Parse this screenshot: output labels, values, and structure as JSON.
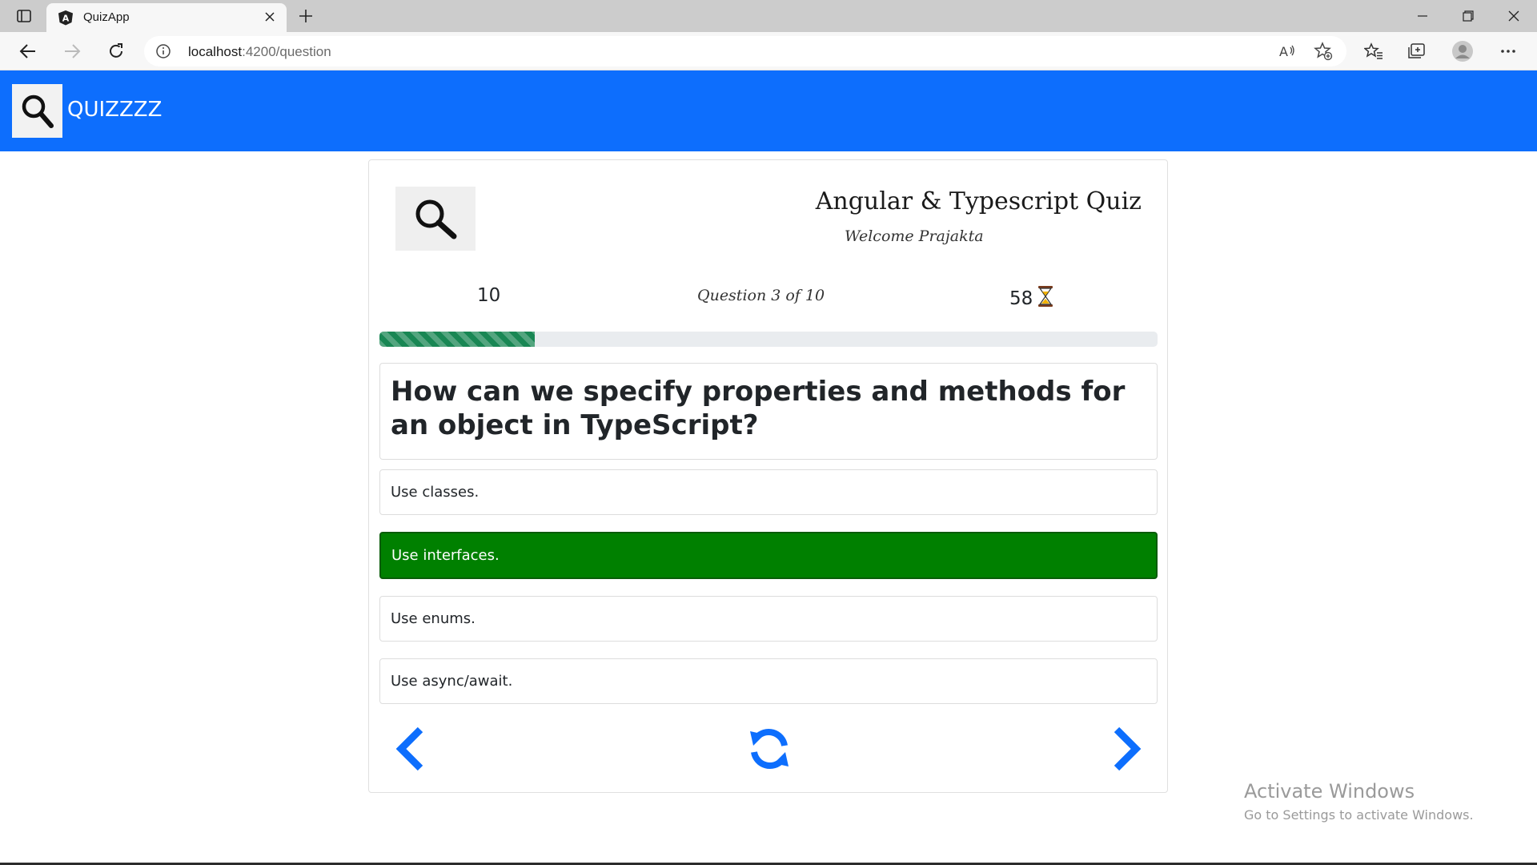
{
  "browser": {
    "tab_title": "QuizApp",
    "url_host": "localhost",
    "url_rest": ":4200/question"
  },
  "navbar": {
    "brand": "QUIZZZZ"
  },
  "quiz": {
    "title": "Angular & Typescript Quiz",
    "welcome": "Welcome Prajakta",
    "points": "10",
    "question_counter": "Question 3 of 10",
    "timer": "58",
    "progress_percent": 20,
    "question": "How can we specify properties and methods for an object in TypeScript?",
    "options": [
      {
        "label": "Use classes.",
        "selected": false
      },
      {
        "label": "Use interfaces.",
        "selected": true
      },
      {
        "label": "Use enums.",
        "selected": false
      },
      {
        "label": "Use async/await.",
        "selected": false
      }
    ]
  },
  "watermark": {
    "title": "Activate Windows",
    "subtitle": "Go to Settings to activate Windows."
  },
  "colors": {
    "navbar": "#0d6efd",
    "selected_option": "#008000",
    "progress": "#198754",
    "nav_icons": "#0d6efd"
  }
}
